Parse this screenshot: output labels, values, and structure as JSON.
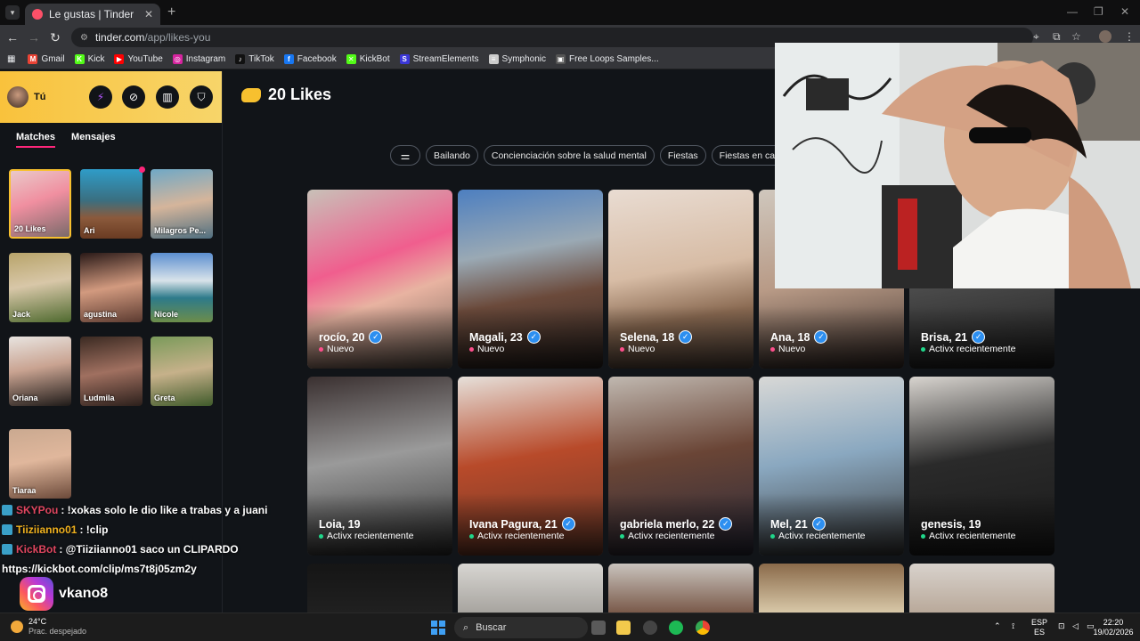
{
  "browser": {
    "tab_title": "Le gustas | Tinder",
    "url_host": "tinder.com",
    "url_path": "/app/likes-you",
    "bookmarks": [
      {
        "label": "Gmail",
        "color": "#ea4335",
        "glyph": "M"
      },
      {
        "label": "Kick",
        "color": "#53fc18",
        "glyph": "K"
      },
      {
        "label": "YouTube",
        "color": "#ff0000",
        "glyph": "▶"
      },
      {
        "label": "Instagram",
        "color": "#d6249f",
        "glyph": "◎"
      },
      {
        "label": "TikTok",
        "color": "#111111",
        "glyph": "♪"
      },
      {
        "label": "Facebook",
        "color": "#1877f2",
        "glyph": "f"
      },
      {
        "label": "KickBot",
        "color": "#53fc18",
        "glyph": "✕"
      },
      {
        "label": "StreamElements",
        "color": "#3b37d8",
        "glyph": "S"
      },
      {
        "label": "Symphonic",
        "color": "#cccccc",
        "glyph": "≡"
      },
      {
        "label": "Free Loops Samples...",
        "color": "#555555",
        "glyph": "▣"
      }
    ]
  },
  "sidebar": {
    "user_name": "Tú",
    "tabs": [
      "Matches",
      "Mensajes"
    ],
    "matches": [
      {
        "label": "20 Likes",
        "bg": "linear-gradient(160deg,#e9c9c9,#f08fa0 45%,#7a6a6a)"
      },
      {
        "label": "Ari",
        "bg": "linear-gradient(180deg,#2f9cc8,#3a6f80 45%,#8b5a3c 70%,#6a3b22)"
      },
      {
        "label": "Milagros Pe...",
        "bg": "linear-gradient(170deg,#6fa8c6,#d5b59b 50%,#4f6f80)"
      },
      {
        "label": "Jack",
        "bg": "linear-gradient(170deg,#b8a46a,#d8c7a8 45%,#4f6a2f)"
      },
      {
        "label": "agustina",
        "bg": "linear-gradient(170deg,#2a1a18,#d29a7f 50%,#5b3a30)"
      },
      {
        "label": "Nicole",
        "bg": "linear-gradient(180deg,#5c8fd0,#d9e3ea 40%,#2d7a8a 65%,#6d8d4a)"
      },
      {
        "label": "Oriana",
        "bg": "linear-gradient(170deg,#e8e4e0,#c9a391 45%,#1e1a18)"
      },
      {
        "label": "Ludmila",
        "bg": "linear-gradient(170deg,#3b2a22,#a07060 50%,#2b1f1b)"
      },
      {
        "label": "Greta",
        "bg": "linear-gradient(170deg,#7a9a5a,#c6b18a 50%,#3f5a2a)"
      },
      {
        "label": "Tiaraa",
        "bg": "linear-gradient(170deg,#caa990,#e0b79c 45%,#6c4a3a)"
      }
    ]
  },
  "chat": [
    {
      "user": "SKYPou",
      "msg": ": !xokas solo le dio like a trabas y a juani"
    },
    {
      "user": "Tiiziianno01",
      "msg": ": !clip"
    },
    {
      "user": "KickBot",
      "msg": ": @Tiiziianno01 saco un CLIPARDO"
    },
    {
      "user": "",
      "msg": "https://kickbot.com/clip/ms7t8j05zm2y"
    }
  ],
  "overlay_handle": "vkano8",
  "main": {
    "title": "20 Likes",
    "chips": [
      "Bailando",
      "Concienciación sobre la salud mental",
      "Fiestas",
      "Fiestas en casa"
    ],
    "cards": [
      {
        "name": "rocío, 20",
        "status": "Nuevo",
        "verified": true,
        "bg": "linear-gradient(160deg,#c8c1b8,#f05e8e 40%,#e8b3a1 60%,#6e6055)"
      },
      {
        "name": "Magali, 23",
        "status": "Nuevo",
        "verified": true,
        "bg": "linear-gradient(170deg,#4d7fc0,#9aa9b4 35%,#6b4a3b 60%,#2a2320)"
      },
      {
        "name": "Selena, 18",
        "status": "Nuevo",
        "verified": true,
        "bg": "linear-gradient(170deg,#e9dcd2,#d7bca5 45%,#8a6a52 70%,#5a4a40)"
      },
      {
        "name": "Ana, 18",
        "status": "Nuevo",
        "verified": true,
        "bg": "linear-gradient(170deg,#cfc7bd,#b89a86 50%,#3a2e2a)"
      },
      {
        "name": "Brisa, 21",
        "status": "Activx recientemente",
        "verified": true,
        "bg": "linear-gradient(170deg,#8a8a8a,#4a4a4a 50%,#1e1e1e)"
      },
      {
        "name": "Loia, 19",
        "status": "Activx recientemente",
        "verified": false,
        "bg": "linear-gradient(170deg,#3a3030,#9a9a9a 45%,#2e2e2e)"
      },
      {
        "name": "Ivana Pagura, 21",
        "status": "Activx recientemente",
        "verified": true,
        "bg": "linear-gradient(170deg,#e6e0da,#b84a2a 45%,#6a3a2a)"
      },
      {
        "name": "gabriela merlo, 22",
        "status": "Activx recientemente",
        "verified": true,
        "bg": "linear-gradient(170deg,#c0b8b0,#6a4536 45%,#2a2a3a)"
      },
      {
        "name": "Mel, 21",
        "status": "Activx recientemente",
        "verified": true,
        "bg": "linear-gradient(170deg,#d8d8d6,#8aa8c0 45%,#3a3a3a)"
      },
      {
        "name": "genesis, 19",
        "status": "Activx recientemente",
        "verified": false,
        "bg": "linear-gradient(170deg,#d8d4cf,#2a2a2a 45%,#1a1a1a)"
      },
      {
        "name": "",
        "status": "",
        "verified": false,
        "bg": "linear-gradient(180deg,#151515,#202020)"
      },
      {
        "name": "",
        "status": "",
        "verified": false,
        "bg": "linear-gradient(180deg,#d8d6d2,#a7a49f)"
      },
      {
        "name": "",
        "status": "",
        "verified": false,
        "bg": "linear-gradient(180deg,#c9c3bd,#7a5a4a)"
      },
      {
        "name": "",
        "status": "",
        "verified": false,
        "bg": "linear-gradient(180deg,#8a6a4a,#d8c8a8)"
      },
      {
        "name": "",
        "status": "",
        "verified": false,
        "bg": "linear-gradient(180deg,#d8d2cc,#b9a99a)"
      }
    ]
  },
  "taskbar": {
    "temp": "24°C",
    "weather": "Prac. despejado",
    "search": "Buscar",
    "lang": "ESP",
    "lang2": "ES",
    "time": "22:20",
    "date": "19/02/2026"
  }
}
